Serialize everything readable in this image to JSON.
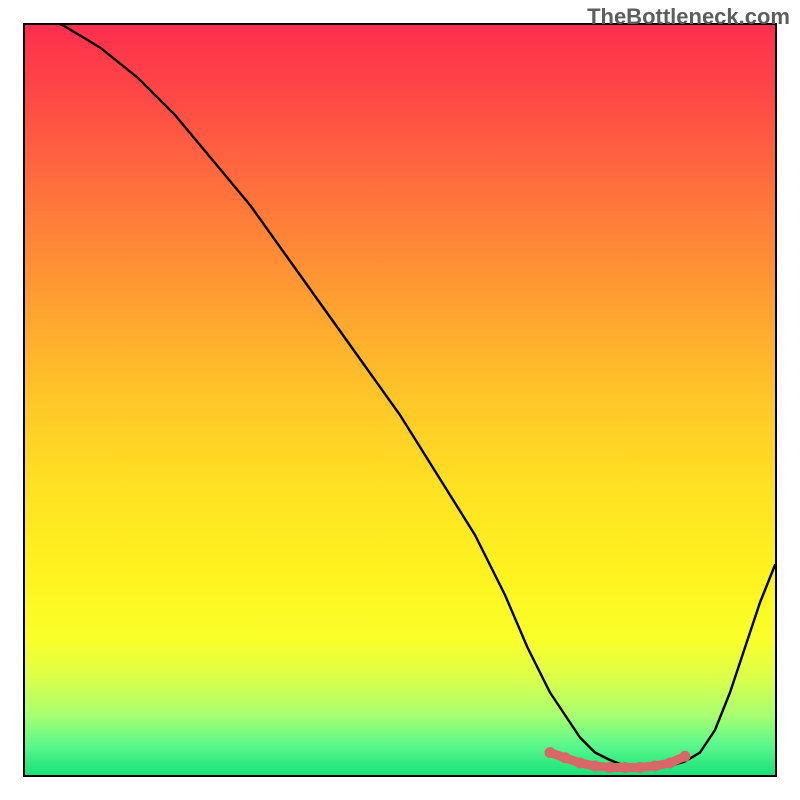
{
  "watermark": "TheBottleneck.com",
  "chart_data": {
    "type": "line",
    "title": "",
    "xlabel": "",
    "ylabel": "",
    "xlim": [
      0,
      100
    ],
    "ylim": [
      0,
      100
    ],
    "series": [
      {
        "name": "bottleneck-curve",
        "x": [
          0,
          5,
          10,
          15,
          20,
          25,
          30,
          35,
          40,
          45,
          50,
          55,
          60,
          64,
          67,
          70,
          72,
          74,
          76,
          78,
          80,
          82,
          84,
          86,
          88,
          90,
          92,
          94,
          96,
          98,
          100
        ],
        "values": [
          102,
          100,
          97,
          93,
          88,
          82,
          76,
          69,
          62,
          55,
          48,
          40,
          32,
          24,
          17,
          11,
          8,
          5,
          3,
          2,
          1.2,
          1,
          1,
          1.2,
          1.8,
          3,
          6,
          11,
          17,
          23,
          28
        ]
      },
      {
        "name": "optimal-region-highlight",
        "x": [
          70,
          72,
          74,
          76,
          78,
          80,
          82,
          84,
          86,
          88
        ],
        "values": [
          3,
          2.3,
          1.6,
          1.2,
          1.0,
          1.0,
          1.0,
          1.2,
          1.6,
          2.5
        ]
      }
    ],
    "colors": {
      "curve": "#000000",
      "highlight": "#d86767",
      "gradient_top": "#ff2e4e",
      "gradient_bottom": "#17e27a"
    }
  }
}
